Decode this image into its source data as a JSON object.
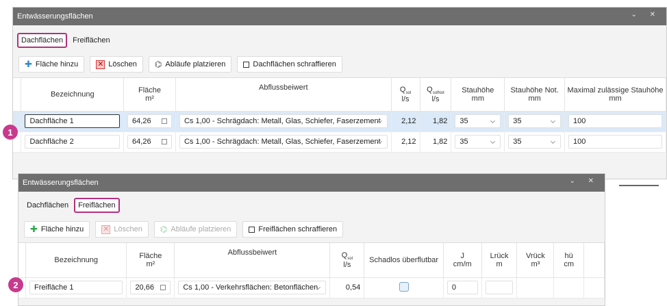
{
  "window1": {
    "title": "Entwässerungsflächen",
    "tabs": [
      {
        "label": "Dachflächen",
        "highlighted": true
      },
      {
        "label": "Freiflächen",
        "highlighted": false
      }
    ],
    "toolbar": {
      "add": "Fläche hinzu",
      "delete": "Löschen",
      "place": "Abläufe platzieren",
      "hatch": "Dachflächen schraffieren"
    },
    "headers": {
      "name": "Bezeichnung",
      "area": "Fläche",
      "area_unit": "m²",
      "coef": "Abflussbeiwert",
      "qsol_unit": "l/s",
      "qsolnot_unit": "l/s",
      "stau": "Stauhöhe",
      "stau_unit": "mm",
      "staunot": "Stauhöhe Not.",
      "staunot_unit": "mm",
      "maxstau": "Maximal zulässige Stauhöhe",
      "maxstau_unit": "mm"
    },
    "rows": [
      {
        "name": "Dachfläche 1",
        "area": "64,26",
        "coef": "Cs 1,00 - Schrägdach: Metall, Glas, Schiefer, Faserzement",
        "qsol": "2,12",
        "qsolnot": "1,82",
        "stau": "35",
        "staunot": "35",
        "maxstau": "100"
      },
      {
        "name": "Dachfläche 2",
        "area": "64,26",
        "coef": "Cs 1,00 - Schrägdach: Metall, Glas, Schiefer, Faserzement",
        "qsol": "2,12",
        "qsolnot": "1,82",
        "stau": "35",
        "staunot": "35",
        "maxstau": "100"
      }
    ]
  },
  "window2": {
    "title": "Entwässerungsflächen",
    "tabs": [
      {
        "label": "Dachflächen",
        "highlighted": false
      },
      {
        "label": "Freiflächen",
        "highlighted": true
      }
    ],
    "toolbar": {
      "add": "Fläche hinzu",
      "delete": "Löschen",
      "place": "Abläufe platzieren",
      "hatch": "Freiflächen schraffieren"
    },
    "headers": {
      "name": "Bezeichnung",
      "area": "Fläche",
      "area_unit": "m²",
      "coef": "Abflussbeiwert",
      "qsol_unit": "l/s",
      "schadlos": "Schadlos überflutbar",
      "j": "J",
      "j_unit": "cm/m",
      "lrueck": "Lrück",
      "lrueck_unit": "m",
      "vrueck": "Vrück",
      "vrueck_unit": "m³",
      "hue": "hü",
      "hue_unit": "cm"
    },
    "rows": [
      {
        "name": "Freifläche 1",
        "area": "20,66",
        "coef": "Cs 1,00 - Verkehrsflächen: Betonflächen",
        "qsol": "0,54",
        "j": "0"
      }
    ]
  },
  "badges": [
    "1",
    "2"
  ],
  "colors": {
    "accent": "#b0317e",
    "badge": "#c73a8d",
    "selected_row": "#dbe9f8",
    "titlebar": "#6e6e6e"
  }
}
